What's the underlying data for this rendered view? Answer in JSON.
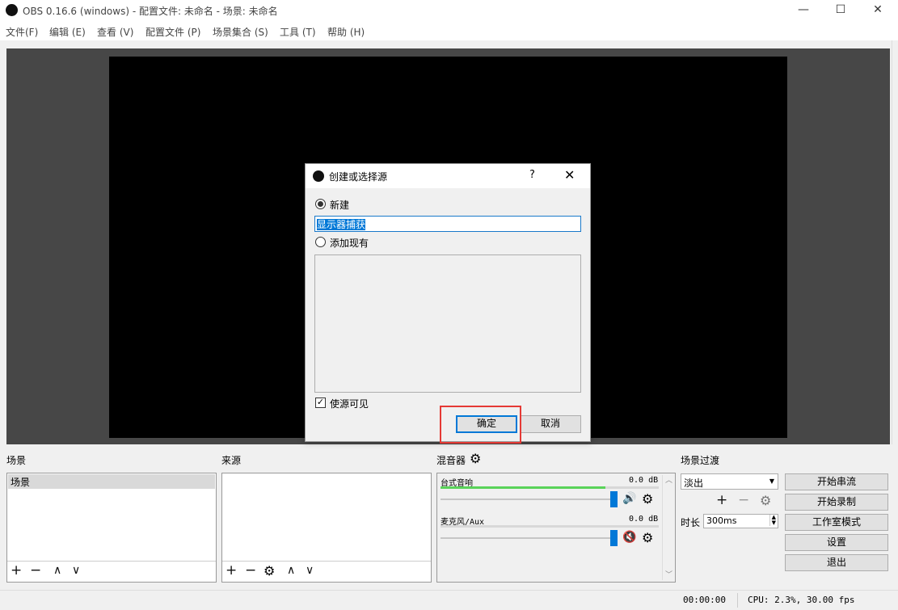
{
  "window": {
    "title": "OBS 0.16.6 (windows) - 配置文件: 未命名 - 场景: 未命名",
    "minimize": "—",
    "maximize": "☐",
    "close": "✕"
  },
  "menu": [
    "文件(F)",
    "编辑 (E)",
    "查看 (V)",
    "配置文件 (P)",
    "场景集合 (S)",
    "工具 (T)",
    "帮助 (H)"
  ],
  "dialog": {
    "title": "创建或选择源",
    "help": "?",
    "close": "✕",
    "radio_new": "新建",
    "name_value": "显示器捕获",
    "radio_existing": "添加现有",
    "visible_checkbox": "使源可见",
    "ok": "确定",
    "cancel": "取消"
  },
  "scenes": {
    "label": "场景",
    "items": [
      "场景"
    ]
  },
  "sources": {
    "label": "来源"
  },
  "mixer": {
    "label": "混音器",
    "channels": [
      {
        "name": "台式音响",
        "db": "0.0 dB",
        "muted": false
      },
      {
        "name": "麦克风/Aux",
        "db": "0.0 dB",
        "muted": true
      }
    ]
  },
  "transitions": {
    "label": "场景过渡",
    "selected": "淡出",
    "duration_label": "时长",
    "duration_value": "300ms"
  },
  "controls": {
    "start_streaming": "开始串流",
    "start_recording": "开始录制",
    "studio_mode": "工作室模式",
    "settings": "设置",
    "exit": "退出"
  },
  "toolbar_glyphs": {
    "add": "+",
    "remove": "−",
    "up": "∧",
    "down": "∨"
  },
  "status": {
    "time": "00:00:00",
    "cpu": "CPU: 2.3%, 30.00 fps"
  },
  "colors": {
    "accent": "#0078d7",
    "highlight": "#e53935",
    "meter": "#5ad35a",
    "muted_icon": "#c62828"
  }
}
